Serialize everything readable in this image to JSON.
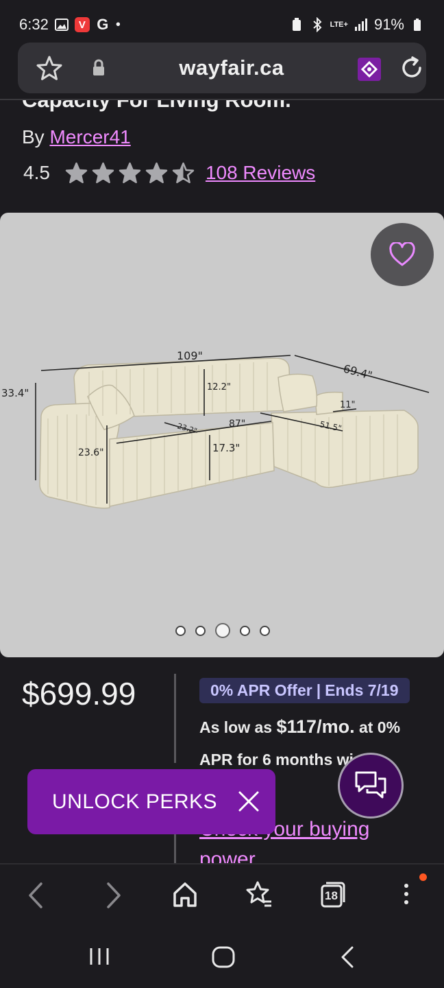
{
  "status_bar": {
    "time": "6:32",
    "battery": "91%",
    "network": "LTE+"
  },
  "browser": {
    "url": "wayfair.ca"
  },
  "product": {
    "title": "Capacity For Living Room.",
    "by_label": "By",
    "brand": "Mercer41",
    "rating": "4.5",
    "rating_value": 4.5,
    "rating_max": 5,
    "reviews_link": "108 Reviews"
  },
  "gallery": {
    "image_count": 5,
    "active_index": 3,
    "dimensions": {
      "width": "109\"",
      "depth": "69.4\"",
      "height": "33.4\"",
      "back": "12.2\"",
      "seat_depth": "23.2\"",
      "seat_width": "87\"",
      "chaise": "51.5\"",
      "arm": "11\"",
      "seat_height": "17.3\"",
      "arm_height": "23.6\""
    }
  },
  "pricing": {
    "price": "$699.99",
    "apr_badge_offer": "0% APR Offer",
    "apr_badge_ends": "Ends 7/19",
    "as_low_as_label": "As low as",
    "monthly": "$117/mo.",
    "at_rate": "at 0%",
    "apr_line2": "APR for 6 months wi",
    "check_link_line1": "Check your buying",
    "check_link_line2": "power"
  },
  "perks_banner": {
    "label": "UNLOCK PERKS"
  },
  "bottom_nav": {
    "tabs_count": "18"
  },
  "colors": {
    "background": "#1c1b1f",
    "link": "#f08bff",
    "perks_purple": "#7a1aa6",
    "apr_badge_bg": "#2f2f55"
  }
}
